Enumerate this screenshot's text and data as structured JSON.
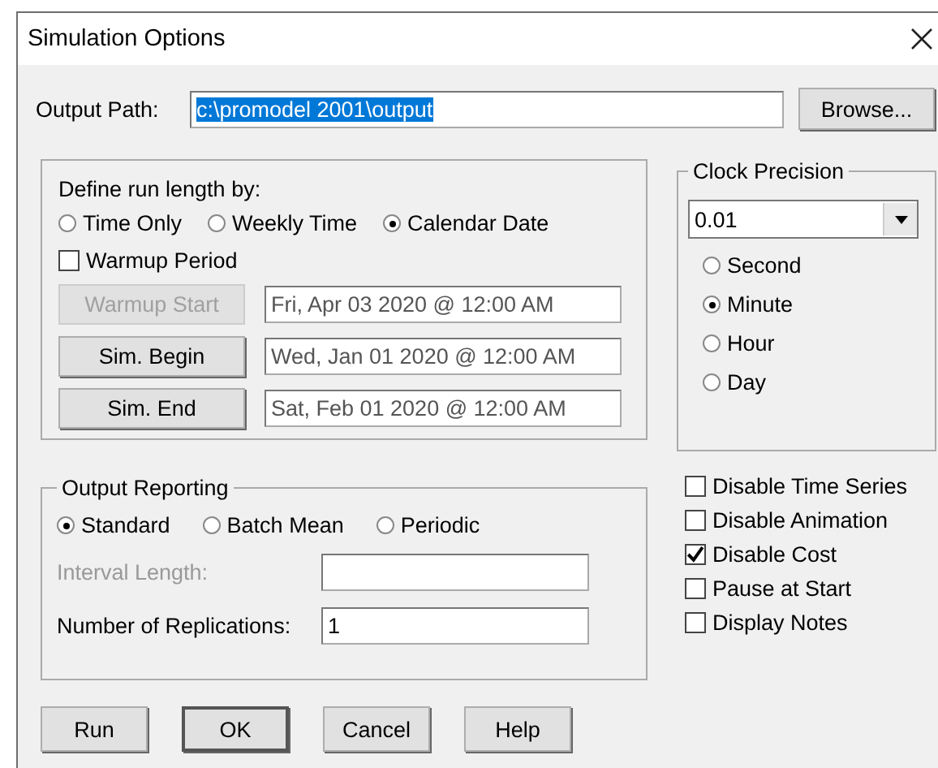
{
  "window": {
    "title": "Simulation Options"
  },
  "output_path": {
    "label": "Output Path:",
    "value": "c:\\promodel 2001\\output",
    "selected": true,
    "browse": "Browse..."
  },
  "run_length": {
    "label": "Define run length by:",
    "options": [
      {
        "label": "Time Only",
        "selected": false
      },
      {
        "label": "Weekly Time",
        "selected": false
      },
      {
        "label": "Calendar Date",
        "selected": true
      }
    ],
    "warmup": {
      "label": "Warmup Period",
      "checked": false
    },
    "dates": [
      {
        "button": "Warmup Start",
        "disabled": true,
        "value": "Fri, Apr 03 2020 @ 12:00 AM"
      },
      {
        "button": "Sim. Begin",
        "disabled": false,
        "value": "Wed, Jan 01 2020 @ 12:00 AM"
      },
      {
        "button": "Sim. End",
        "disabled": false,
        "value": "Sat, Feb 01 2020 @ 12:00 AM"
      }
    ]
  },
  "clock_precision": {
    "title": "Clock Precision",
    "value": "0.01",
    "units": [
      {
        "label": "Second",
        "selected": false
      },
      {
        "label": "Minute",
        "selected": true
      },
      {
        "label": "Hour",
        "selected": false
      },
      {
        "label": "Day",
        "selected": false
      }
    ]
  },
  "output_reporting": {
    "title": "Output Reporting",
    "options": [
      {
        "label": "Standard",
        "selected": true
      },
      {
        "label": "Batch Mean",
        "selected": false
      },
      {
        "label": "Periodic",
        "selected": false
      }
    ],
    "fields": [
      {
        "label": "Interval Length:",
        "disabled": true
      },
      {
        "label": "Number of Replications:",
        "disabled": false,
        "value": "1"
      }
    ]
  },
  "options": [
    {
      "label": "Disable Time Series",
      "checked": false
    },
    {
      "label": "Disable Animation",
      "checked": false
    },
    {
      "label": "Disable Cost",
      "checked": true
    },
    {
      "label": "Pause at Start",
      "checked": false
    },
    {
      "label": "Display Notes",
      "checked": false
    }
  ],
  "buttons": [
    {
      "label": "Run",
      "default": false
    },
    {
      "label": "OK",
      "default": true
    },
    {
      "label": "Cancel",
      "default": false
    },
    {
      "label": "Help",
      "default": false
    }
  ]
}
